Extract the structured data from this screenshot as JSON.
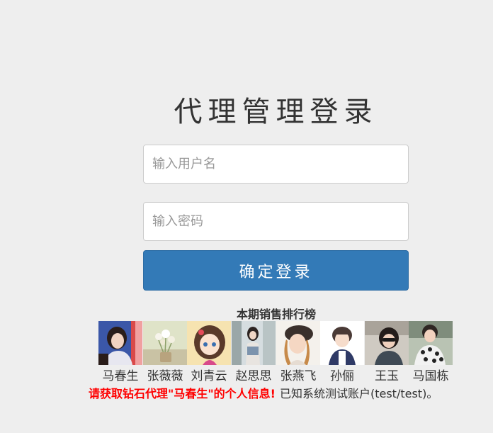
{
  "login": {
    "title": "代理管理登录",
    "username_placeholder": "输入用户名",
    "username_value": "",
    "password_placeholder": "输入密码",
    "password_value": "",
    "submit_label": "确定登录"
  },
  "ranking": {
    "title": "本期销售排行榜",
    "agents": [
      {
        "name": "马春生",
        "avatar": "photo-woman-red-bg"
      },
      {
        "name": "张薇薇",
        "avatar": "photo-flowers"
      },
      {
        "name": "刘青云",
        "avatar": "cartoon-girl"
      },
      {
        "name": "赵思思",
        "avatar": "photo-woman-outdoor"
      },
      {
        "name": "张燕飞",
        "avatar": "photo-woman-hat"
      },
      {
        "name": "孙俪",
        "avatar": "photo-person-white-bg"
      },
      {
        "name": "王玉",
        "avatar": "photo-woman-sunglasses"
      },
      {
        "name": "马国栋",
        "avatar": "photo-man-patterned-shirt"
      }
    ]
  },
  "notice": {
    "highlight": "请获取钻石代理\"马春生\"的个人信息!",
    "text": "已知系统测试账户(test/test)。"
  },
  "colors": {
    "background": "#eeeeee",
    "primary": "#337ab7",
    "alert": "#ff0000"
  }
}
